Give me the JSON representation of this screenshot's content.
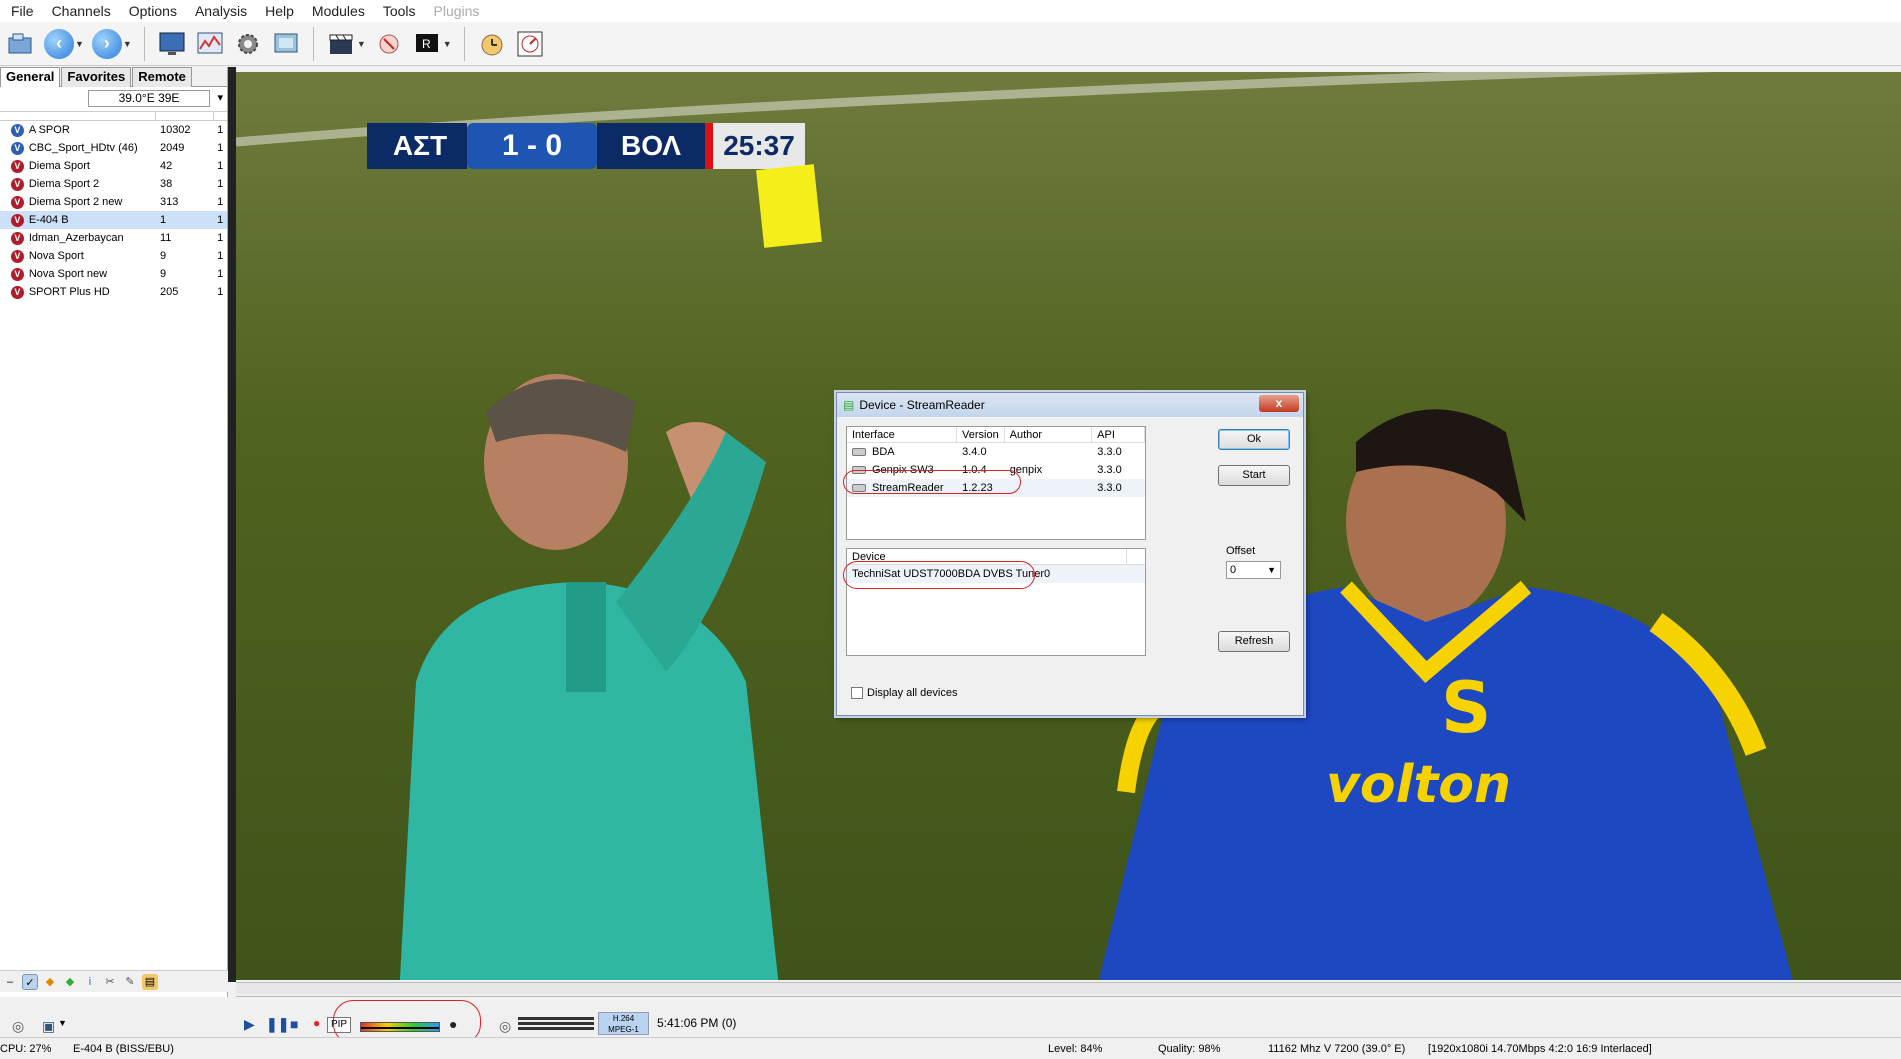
{
  "menu": [
    "File",
    "Channels",
    "Options",
    "Analysis",
    "Help",
    "Modules",
    "Tools"
  ],
  "menu_disabled": "Plugins",
  "left_tabs": [
    "General",
    "Favorites",
    "Remote"
  ],
  "satellite": "39.0°E 39E",
  "channels": [
    {
      "name": "A SPOR",
      "num": "10302",
      "flag": "1",
      "icon": "blue"
    },
    {
      "name": "CBC_Sport_HDtv (46)",
      "num": "2049",
      "flag": "1",
      "icon": "blue"
    },
    {
      "name": "Diema Sport",
      "num": "42",
      "flag": "1",
      "icon": "red"
    },
    {
      "name": "Diema Sport 2",
      "num": "38",
      "flag": "1",
      "icon": "red"
    },
    {
      "name": "Diema Sport 2 new",
      "num": "313",
      "flag": "1",
      "icon": "red"
    },
    {
      "name": "E-404 B",
      "num": "1",
      "flag": "1",
      "icon": "red",
      "selected": true
    },
    {
      "name": "Idman_Azerbaycan",
      "num": "11",
      "flag": "1",
      "icon": "red"
    },
    {
      "name": "Nova Sport",
      "num": "9",
      "flag": "1",
      "icon": "red"
    },
    {
      "name": "Nova Sport new",
      "num": "9",
      "flag": "1",
      "icon": "red"
    },
    {
      "name": "SPORT Plus HD",
      "num": "205",
      "flag": "1",
      "icon": "red"
    }
  ],
  "scoreboard": {
    "home": "ΑΣΤ",
    "score": "1 - 0",
    "away": "ΒΟΛ",
    "time": "25:37"
  },
  "sponsor": "volton",
  "dialog": {
    "title": "Device - StreamReader",
    "close": "x",
    "columns": [
      "Interface",
      "Version",
      "Author",
      "API"
    ],
    "interfaces": [
      {
        "name": "BDA",
        "version": "3.4.0",
        "author": "",
        "api": "3.3.0"
      },
      {
        "name": "Genpix SW3",
        "version": "1.0.4",
        "author": "genpix",
        "api": "3.3.0"
      },
      {
        "name": "StreamReader",
        "version": "1.2.23",
        "author": "",
        "api": "3.3.0"
      }
    ],
    "device_header": "Device",
    "device": "TechniSat UDST7000BDA DVBS Tuner0",
    "display_all_label": "Display all devices",
    "ok": "Ok",
    "start": "Start",
    "offset_label": "Offset",
    "offset_value": "0",
    "refresh": "Refresh"
  },
  "playbar": {
    "pip": "PIP",
    "codec1": "H.264",
    "codec2": "MPEG-1",
    "clock": "5:41:06 PM  (0)"
  },
  "status": {
    "cpu": "CPU: 27%",
    "channel": "E-404 B (BISS/EBU)",
    "level": "Level: 84%",
    "quality": "Quality: 98%",
    "freq": "11162 Mhz  V  7200  (39.0° E)",
    "format": "[1920x1080i  14.70Mbps 4:2:0  16:9 Interlaced]"
  },
  "colors": {
    "accent": "#2a7bd6",
    "highlight": "#cce0f7",
    "mark": "#dd2222"
  }
}
